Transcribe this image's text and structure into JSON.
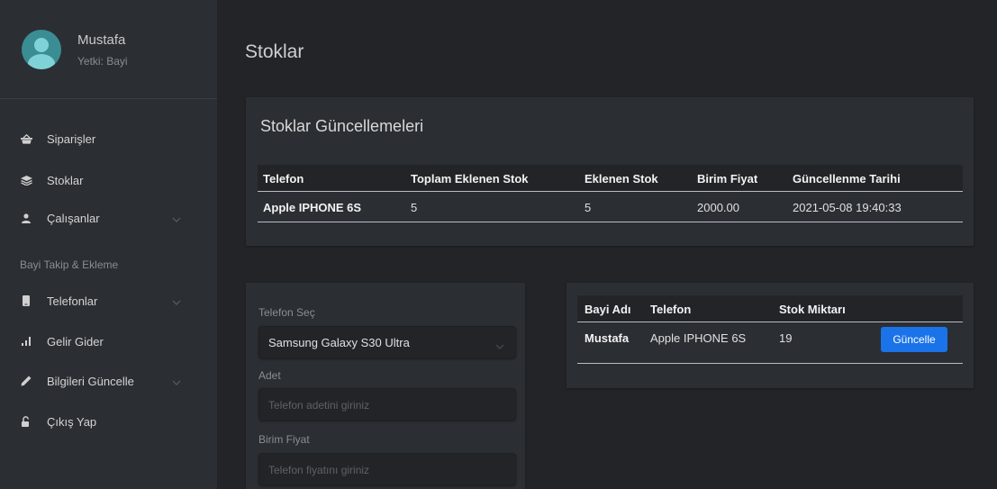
{
  "user": {
    "name": "Mustafa",
    "role": "Yetki: Bayi"
  },
  "sidebar": {
    "items": [
      {
        "label": "Siparişler",
        "icon": "basket-icon"
      },
      {
        "label": "Stoklar",
        "icon": "layers-icon"
      },
      {
        "label": "Çalışanlar",
        "icon": "user-icon",
        "has_submenu": true
      },
      {
        "label": "Telefonlar",
        "icon": "phone-icon",
        "has_submenu": true
      },
      {
        "label": "Gelir Gider",
        "icon": "bar-chart-icon"
      },
      {
        "label": "Bilgileri Güncelle",
        "icon": "pencil-icon",
        "has_submenu": true
      },
      {
        "label": "Çıkış Yap",
        "icon": "unlock-icon"
      }
    ],
    "section_label": "Bayi Takip & Ekleme"
  },
  "page": {
    "title": "Stoklar"
  },
  "updates": {
    "title": "Stoklar Güncellemeleri",
    "columns": [
      "Telefon",
      "Toplam Eklenen Stok",
      "Eklenen Stok",
      "Birim Fiyat",
      "Güncellenme Tarihi"
    ],
    "rows": [
      [
        "Apple IPHONE 6S",
        "5",
        "5",
        "2000.00",
        "2021-05-08 19:40:33"
      ]
    ]
  },
  "form": {
    "phone_label": "Telefon Seç",
    "phone_selected": "Samsung Galaxy S30 Ultra",
    "quantity_label": "Adet",
    "quantity_placeholder": "Telefon adetini giriniz",
    "price_label": "Birim Fiyat",
    "price_placeholder": "Telefon fiyatını giriniz"
  },
  "stock": {
    "columns": [
      "Bayi Adı",
      "Telefon",
      "Stok Miktarı"
    ],
    "rows": [
      {
        "dealer": "Mustafa",
        "phone": "Apple IPHONE 6S",
        "quantity": "19",
        "action": "Güncelle"
      }
    ]
  },
  "colors": {
    "accent": "#1a73e8",
    "background": "#222428",
    "panel": "#2b2e33"
  }
}
